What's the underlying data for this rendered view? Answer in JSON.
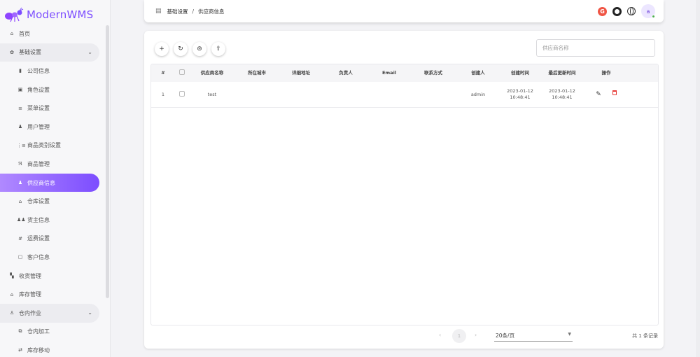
{
  "app": {
    "title": "ModernWMS"
  },
  "sidebar": {
    "items": [
      {
        "label": "首页",
        "icon": "home-icon",
        "glyph": "⌂",
        "kind": "top"
      },
      {
        "label": "基础设置",
        "icon": "gear-icon",
        "glyph": "✿",
        "kind": "group",
        "expanded": true
      },
      {
        "label": "公司信息",
        "icon": "building-icon",
        "glyph": "▮",
        "kind": "sub"
      },
      {
        "label": "角色设置",
        "icon": "badge-icon",
        "glyph": "▣",
        "kind": "sub"
      },
      {
        "label": "菜单设置",
        "icon": "menu-icon",
        "glyph": "≡",
        "kind": "sub"
      },
      {
        "label": "用户管理",
        "icon": "user-icon",
        "glyph": "♟",
        "kind": "sub"
      },
      {
        "label": "商品类别设置",
        "icon": "category-icon",
        "glyph": "⋮≡",
        "kind": "sub"
      },
      {
        "label": "商品管理",
        "icon": "cart-icon",
        "glyph": "ℜ",
        "kind": "sub"
      },
      {
        "label": "供应商信息",
        "icon": "supplier-icon",
        "glyph": "♟",
        "kind": "sub",
        "active": true
      },
      {
        "label": "仓库设置",
        "icon": "warehouse-icon",
        "glyph": "⌂",
        "kind": "sub"
      },
      {
        "label": "货主信息",
        "icon": "owners-icon",
        "glyph": "♟♟",
        "kind": "sub"
      },
      {
        "label": "运费设置",
        "icon": "freight-icon",
        "glyph": "#",
        "kind": "sub"
      },
      {
        "label": "客户信息",
        "icon": "customer-icon",
        "glyph": "▢",
        "kind": "sub"
      },
      {
        "label": "收货管理",
        "icon": "receiving-icon",
        "glyph": "▚",
        "kind": "top"
      },
      {
        "label": "库存管理",
        "icon": "stock-icon",
        "glyph": "⌂",
        "kind": "top"
      },
      {
        "label": "仓内作业",
        "icon": "operation-icon",
        "glyph": "♙",
        "kind": "group",
        "expanded": true
      },
      {
        "label": "仓内加工",
        "icon": "processing-icon",
        "glyph": "⧉",
        "kind": "sub"
      },
      {
        "label": "库存移动",
        "icon": "move-icon",
        "glyph": "⇄",
        "kind": "sub"
      }
    ]
  },
  "header": {
    "breadcrumb": [
      "基础设置",
      "供应商信息"
    ],
    "separator": "/",
    "avatar_letter": "a"
  },
  "toolbar": {
    "buttons": [
      {
        "name": "add-button",
        "glyph": "+"
      },
      {
        "name": "refresh-button",
        "glyph": "↻"
      },
      {
        "name": "import-button",
        "glyph": "⊜"
      },
      {
        "name": "export-button",
        "glyph": "⇧"
      }
    ]
  },
  "search": {
    "placeholder": "供应商名称",
    "value": ""
  },
  "table": {
    "columns": [
      "#",
      "",
      "供应商名称",
      "所在城市",
      "详细地址",
      "负责人",
      "Email",
      "联系方式",
      "创建人",
      "创建时间",
      "最后更新时间",
      "操作"
    ],
    "rows": [
      {
        "index": "1",
        "name": "test",
        "city": "",
        "address": "",
        "contact": "",
        "email": "",
        "tel": "",
        "creator": "admin",
        "create_time": "2023-01-12 10:48:41",
        "update_time": "2023-01-12 10:48:41"
      }
    ]
  },
  "pager": {
    "prev": "‹",
    "current": "1",
    "next": "›",
    "page_size": "20条/页",
    "total": "共 1 条记录"
  },
  "colors": {
    "accent": "#7c4dff",
    "danger": "#e53935"
  }
}
